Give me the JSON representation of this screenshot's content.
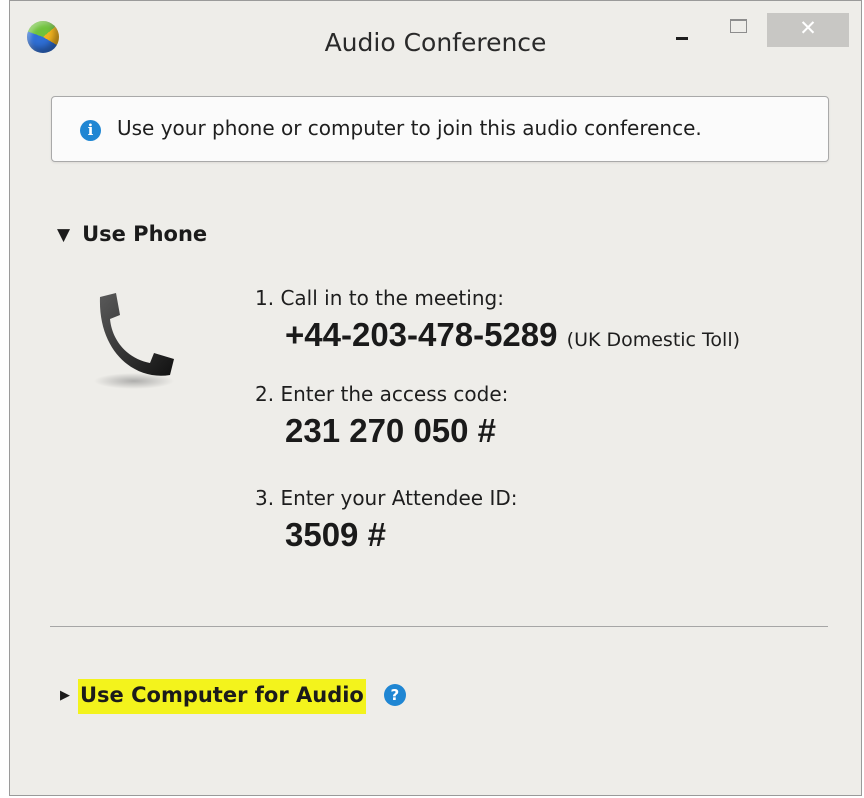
{
  "window": {
    "title": "Audio Conference",
    "close_glyph": "✕",
    "colors": {
      "background": "#eeede9",
      "accent": "#1f86d3",
      "highlight": "#f3f31c"
    }
  },
  "info": {
    "icon": "info-icon",
    "icon_glyph": "i",
    "text": "Use your phone or computer to join this audio conference."
  },
  "use_phone": {
    "toggle_glyph": "▼",
    "label": "Use Phone",
    "icon": "phone-handset-icon",
    "steps": [
      {
        "label": "1. Call in to the meeting:",
        "value": "+44-203-478-5289",
        "note": "(UK Domestic Toll)"
      },
      {
        "label": "2. Enter the access code:",
        "value": "231 270 050 #"
      },
      {
        "label": "3. Enter your Attendee ID:",
        "value": "3509 #"
      }
    ]
  },
  "use_computer": {
    "toggle_glyph": "▶",
    "label": "Use Computer for Audio",
    "help_icon": "help-icon",
    "help_glyph": "?"
  }
}
